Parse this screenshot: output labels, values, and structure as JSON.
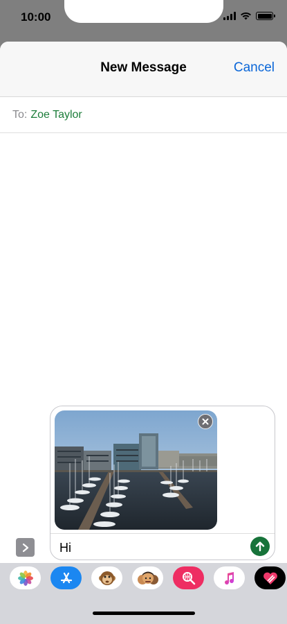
{
  "status_bar": {
    "time": "10:00"
  },
  "nav": {
    "title": "New Message",
    "cancel_label": "Cancel"
  },
  "recipient": {
    "label": "To:",
    "value": "Zoe Taylor"
  },
  "composer": {
    "message_text": "Hi",
    "attachment_description": "harbor-marina-photo"
  },
  "app_drawer": {
    "apps": [
      {
        "icon": "photos-icon"
      },
      {
        "icon": "app-store-icon"
      },
      {
        "icon": "monkey-animoji-icon"
      },
      {
        "icon": "memoji-stickers-icon"
      },
      {
        "icon": "web-search-icon"
      },
      {
        "icon": "music-icon"
      },
      {
        "icon": "digital-touch-icon"
      }
    ]
  },
  "colors": {
    "accent": "#0a66d8",
    "recipient_green": "#1c7d3a",
    "send_button": "#17733a"
  }
}
